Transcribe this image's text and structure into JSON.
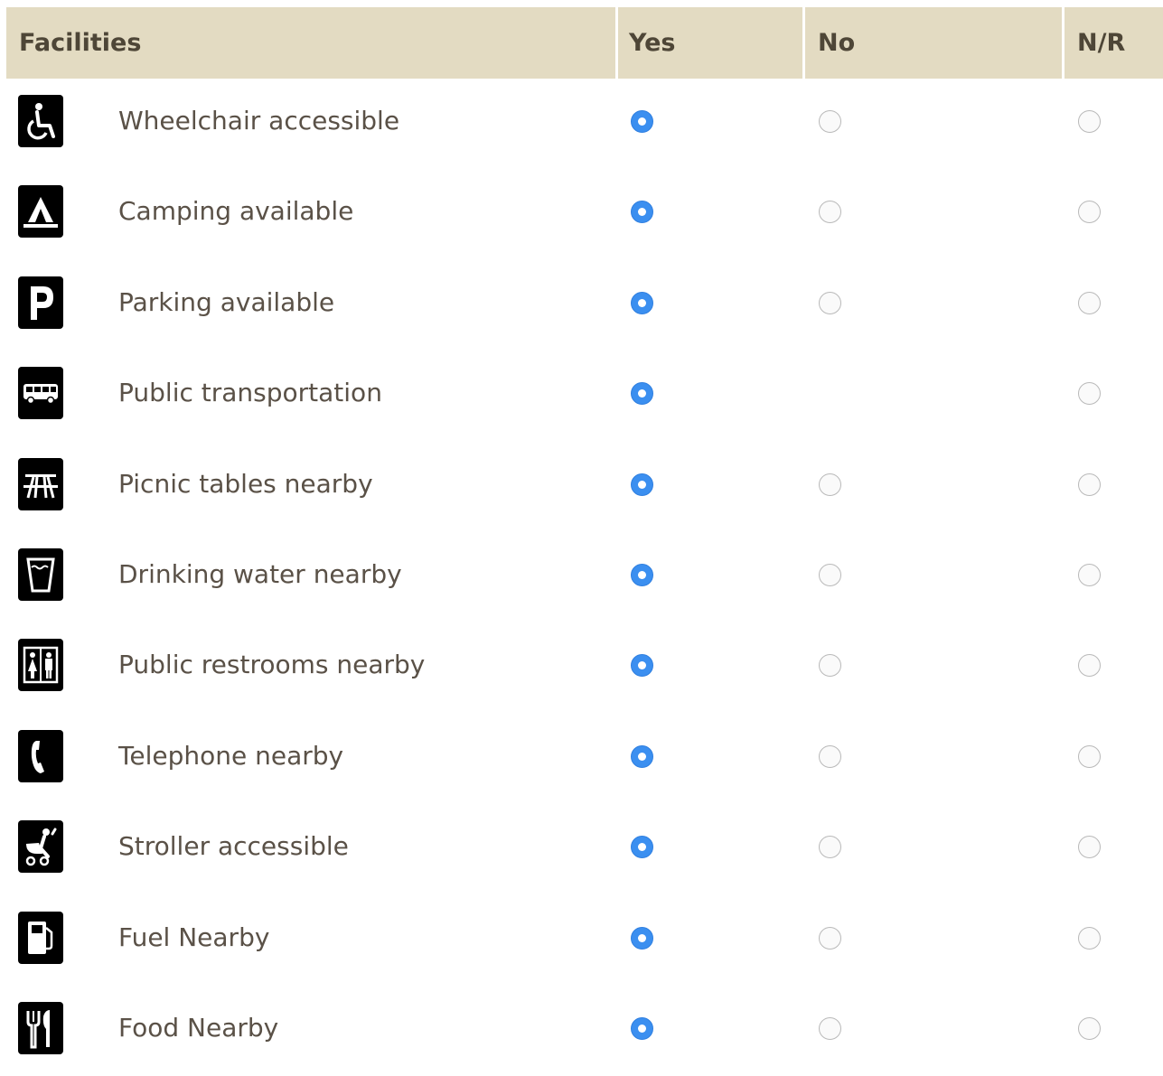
{
  "header": {
    "facilities_label": "Facilities",
    "yes_label": "Yes",
    "no_label": "No",
    "nr_label": "N/R"
  },
  "colors": {
    "header_bg": "#e3dbc2",
    "selected_radio": "#3b8ff0",
    "label_text": "#5a5147"
  },
  "rows": [
    {
      "icon": "wheelchair-icon",
      "label": "Wheelchair accessible",
      "selected": "yes",
      "options": [
        "yes",
        "no",
        "nr"
      ]
    },
    {
      "icon": "tent-icon",
      "label": "Camping available",
      "selected": "yes",
      "options": [
        "yes",
        "no",
        "nr"
      ]
    },
    {
      "icon": "parking-icon",
      "label": "Parking available",
      "selected": "yes",
      "options": [
        "yes",
        "no",
        "nr"
      ]
    },
    {
      "icon": "bus-icon",
      "label": "Public transportation",
      "selected": "yes",
      "options": [
        "yes",
        "nr"
      ]
    },
    {
      "icon": "picnic-table-icon",
      "label": "Picnic tables nearby",
      "selected": "yes",
      "options": [
        "yes",
        "no",
        "nr"
      ]
    },
    {
      "icon": "drinking-water-icon",
      "label": "Drinking water nearby",
      "selected": "yes",
      "options": [
        "yes",
        "no",
        "nr"
      ]
    },
    {
      "icon": "restroom-icon",
      "label": "Public restrooms nearby",
      "selected": "yes",
      "options": [
        "yes",
        "no",
        "nr"
      ]
    },
    {
      "icon": "telephone-icon",
      "label": "Telephone nearby",
      "selected": "yes",
      "options": [
        "yes",
        "no",
        "nr"
      ]
    },
    {
      "icon": "stroller-icon",
      "label": "Stroller accessible",
      "selected": "yes",
      "options": [
        "yes",
        "no",
        "nr"
      ]
    },
    {
      "icon": "fuel-pump-icon",
      "label": "Fuel Nearby",
      "selected": "yes",
      "options": [
        "yes",
        "no",
        "nr"
      ]
    },
    {
      "icon": "fork-knife-icon",
      "label": "Food Nearby",
      "selected": "yes",
      "options": [
        "yes",
        "no",
        "nr"
      ]
    }
  ]
}
